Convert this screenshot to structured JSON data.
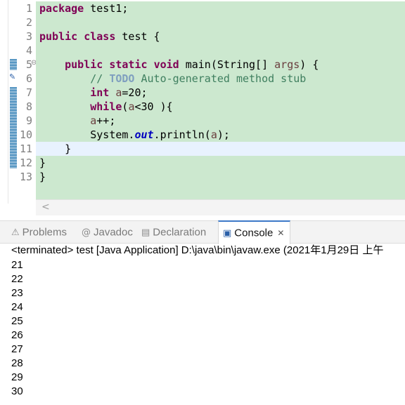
{
  "editor": {
    "line_numbers": [
      "1",
      "2",
      "3",
      "4",
      "5",
      "6",
      "7",
      "8",
      "9",
      "10",
      "11",
      "12",
      "13"
    ],
    "lines": {
      "l1_kw": "package",
      "l1_rest": " test1;",
      "l3_kw1": "public",
      "l3_kw2": "class",
      "l3_rest": " test {",
      "l5_indent": "    ",
      "l5_kw1": "public",
      "l5_kw2": "static",
      "l5_kw3": "void",
      "l5_mid": " main(String[] ",
      "l5_var": "args",
      "l5_end": ") {",
      "l6_indent": "        ",
      "l6_comment": "// ",
      "l6_todo": "TODO",
      "l6_rest": " Auto-generated method stub",
      "l7_indent": "        ",
      "l7_kw": "int",
      "l7_sp": " ",
      "l7_var": "a",
      "l7_rest": "=20;",
      "l8_indent": "        ",
      "l8_kw": "while",
      "l8_p1": "(",
      "l8_var": "a",
      "l8_rest": "<30 ){",
      "l9_indent": "        ",
      "l9_var": "a",
      "l9_rest": "++;",
      "l10_indent": "        ",
      "l10_pre": "System.",
      "l10_field": "out",
      "l10_mid": ".println(",
      "l10_var": "a",
      "l10_end": ");",
      "l11": "    }",
      "l12": "}",
      "l13": "}"
    },
    "fold_icon": "minus-fold-icon",
    "warning_icon": "task-marker-icon",
    "scroll_arrow": "<"
  },
  "panel": {
    "tabs": [
      {
        "label": "Problems",
        "icon": "problems-icon",
        "glyph": "⚠"
      },
      {
        "label": "Javadoc",
        "icon": "javadoc-icon",
        "glyph": "@"
      },
      {
        "label": "Declaration",
        "icon": "declaration-icon",
        "glyph": "▤"
      },
      {
        "label": "Console",
        "icon": "console-icon",
        "glyph": "▣",
        "active": true,
        "close": "✕"
      }
    ],
    "status": "<terminated> test [Java Application] D:\\java\\bin\\javaw.exe (2021年1月29日 上午",
    "output": [
      "21",
      "22",
      "23",
      "24",
      "25",
      "26",
      "27",
      "28",
      "29",
      "30"
    ]
  },
  "colors": {
    "editor_bg": "#cce8cf",
    "current_line": "#e8f2fe",
    "keyword": "#7f0055",
    "comment": "#3f7f5f",
    "todo": "#7f9fbf",
    "field": "#0000c0",
    "active_tab_accent": "#3c78c8"
  }
}
